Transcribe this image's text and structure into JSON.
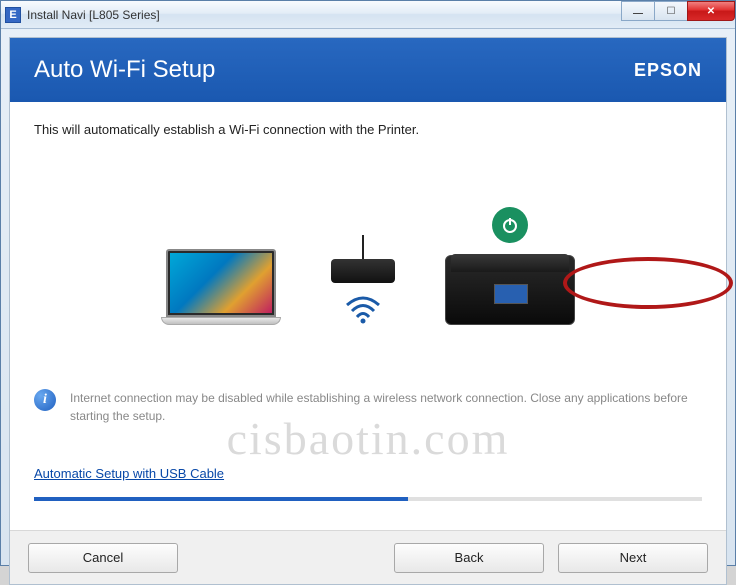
{
  "window": {
    "title": "Install Navi [L805 Series]",
    "icon_letter": "E"
  },
  "header": {
    "title": "Auto Wi-Fi Setup",
    "brand": "EPSON"
  },
  "content": {
    "description": "This will automatically establish a Wi-Fi connection with the Printer.",
    "info_note": "Internet connection may be disabled while establishing a wireless network connection. Close any applications before starting the setup.",
    "alt_link": "Automatic Setup with USB Cable"
  },
  "buttons": {
    "cancel": "Cancel",
    "back": "Back",
    "next": "Next"
  },
  "watermark": "cisbaotin.com"
}
